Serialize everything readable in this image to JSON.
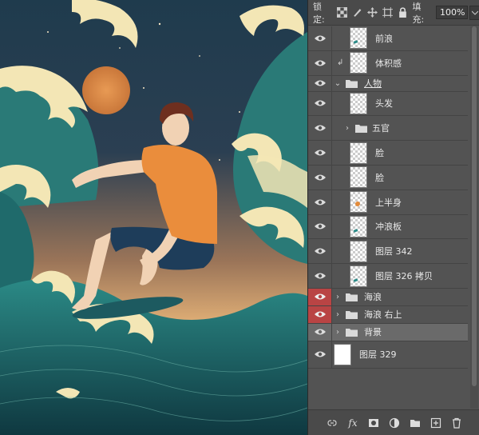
{
  "lock_bar": {
    "lock_label": "锁定:",
    "fill_label": "填充:",
    "fill_value": "100%"
  },
  "layers": [
    {
      "name": "前浪",
      "type": "layer",
      "visible": true,
      "thumb": "wave-mark"
    },
    {
      "name": "体积感",
      "type": "layer",
      "visible": true,
      "clipped": true,
      "thumb": "empty"
    },
    {
      "name": "人物",
      "type": "group",
      "visible": true,
      "expanded": true
    },
    {
      "name": "头发",
      "type": "layer",
      "visible": true,
      "thumb": "empty"
    },
    {
      "name": "五官",
      "type": "group",
      "visible": true,
      "expanded": false
    },
    {
      "name": "脸",
      "type": "layer",
      "visible": true,
      "thumb": "empty"
    },
    {
      "name": "脸",
      "type": "layer",
      "visible": true,
      "thumb": "empty"
    },
    {
      "name": "上半身",
      "type": "layer",
      "visible": true,
      "thumb": "orange-mark"
    },
    {
      "name": "冲浪板",
      "type": "layer",
      "visible": true,
      "thumb": "wave-mark"
    },
    {
      "name": "图层 342",
      "type": "layer",
      "visible": true,
      "thumb": "empty"
    },
    {
      "name": "图层 326 拷贝",
      "type": "layer",
      "visible": true,
      "thumb": "wave-mark"
    },
    {
      "name": "海浪",
      "type": "group",
      "visible": true,
      "expanded": false,
      "color": "red"
    },
    {
      "name": "海浪 右上",
      "type": "group",
      "visible": true,
      "expanded": false,
      "color": "red"
    },
    {
      "name": "背景",
      "type": "group",
      "visible": true,
      "expanded": false,
      "selected": true
    },
    {
      "name": "图层 329",
      "type": "layer",
      "visible": true,
      "thumb": "white"
    }
  ],
  "bottom_tools": [
    "link-icon",
    "fx-icon",
    "mask-icon",
    "adjustment-icon",
    "folder-icon",
    "new-layer-icon",
    "trash-icon"
  ],
  "colors": {
    "panel_bg": "#535353",
    "selected_row": "#6a6a6a",
    "red_label": "#b94444"
  }
}
